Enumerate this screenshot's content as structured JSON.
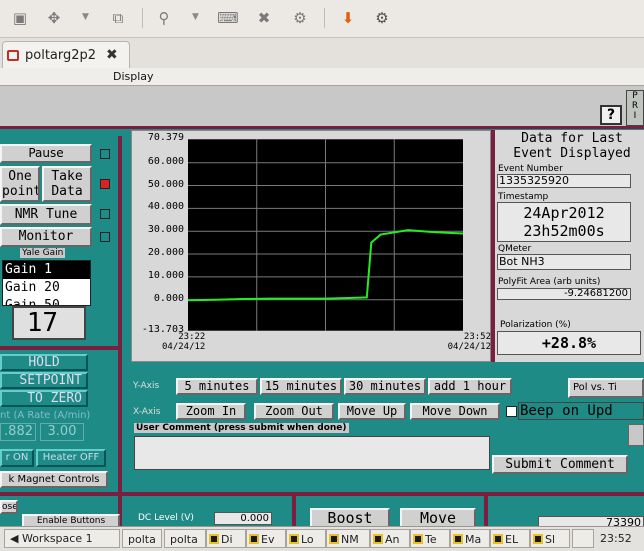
{
  "tab": {
    "title": "poltarg2p2"
  },
  "menu": {
    "display": "Display"
  },
  "pbox": "P\nR\nI",
  "help": "?",
  "left": {
    "pause": "Pause",
    "one_point": "One\npoint",
    "take_data": "Take\nData",
    "nmr_tune": "NMR Tune",
    "monitor": "Monitor",
    "yale_gain": "Yale Gain",
    "gain_options": [
      "Gain 1",
      "Gain 20",
      "Gain 50"
    ],
    "gain_display": "17",
    "hold": "HOLD",
    "setpoint": "SETPOINT",
    "to_zero": "TO ZERO",
    "rate_label": "nt (A Rate (A/min)",
    "rate_current": ".882",
    "rate_set": "3.00",
    "heater_on": "r ON",
    "heater_off": "Heater OFF",
    "magnet_controls": "k Magnet Controls",
    "lose": "ose",
    "enable_buttons": "Enable Buttons"
  },
  "chart_data": {
    "type": "line",
    "title": "",
    "xlabel": "",
    "ylabel": "",
    "yticks": [
      "70.379",
      "60.000",
      "50.000",
      "40.000",
      "30.000",
      "20.000",
      "10.000",
      "0.000",
      "-13.703"
    ],
    "ylim": [
      -13.703,
      70.379
    ],
    "xticks": [
      [
        "23:22",
        "04/24/12"
      ],
      [
        "23:52",
        "04/24/12"
      ]
    ],
    "grid": true,
    "line_color": "#22ee22",
    "series": [
      {
        "x": [
          0,
          3,
          6,
          9,
          12,
          15,
          18,
          19.5,
          20,
          21,
          24,
          27,
          30
        ],
        "values": [
          -0.2,
          0.0,
          0.3,
          0.5,
          0.5,
          0.5,
          0.8,
          1.0,
          25.0,
          28.5,
          30.5,
          29.5,
          29.0
        ]
      }
    ]
  },
  "info": {
    "header": "Data for Last\nEvent Displayed",
    "event_number_label": "Event Number",
    "event_number": "1335325920",
    "timestamp_label": "Timestamp",
    "date": "24Apr2012",
    "time": "23h52m00s",
    "qmeter_label": "QMeter",
    "qmeter": "Bot NH3",
    "polyfit_label": "PolyFit Area (arb units)",
    "polyfit": "-9.24681200",
    "polarization_label": "Polarization (%)",
    "polarization": "+28.8%"
  },
  "xaxis": {
    "label": "X-Axis",
    "buttons": [
      "5 minutes",
      "15 minutes",
      "30 minutes",
      "add 1 hour"
    ]
  },
  "yaxis": {
    "label": "Y-Axis",
    "buttons": [
      "Zoom In",
      "Zoom Out",
      "Move Up",
      "Move Down"
    ]
  },
  "pol_vs": "Pol vs. Ti",
  "beep": "Beep on Upd",
  "comment": {
    "label": "User Comment (press submit when done)",
    "submit": "Submit Comment"
  },
  "bottom": {
    "dc_label": "DC Level (V)",
    "dc_value": "0.000",
    "boost": "Boost",
    "move": "Move",
    "counter": "73390"
  },
  "taskbar": {
    "workspace": "Workspace 1",
    "items": [
      "polta",
      "polta",
      "Di",
      "Ev",
      "Lo",
      "NM",
      "An",
      "Te",
      "Ma",
      "EL",
      "Sl"
    ],
    "time": "23:52"
  }
}
